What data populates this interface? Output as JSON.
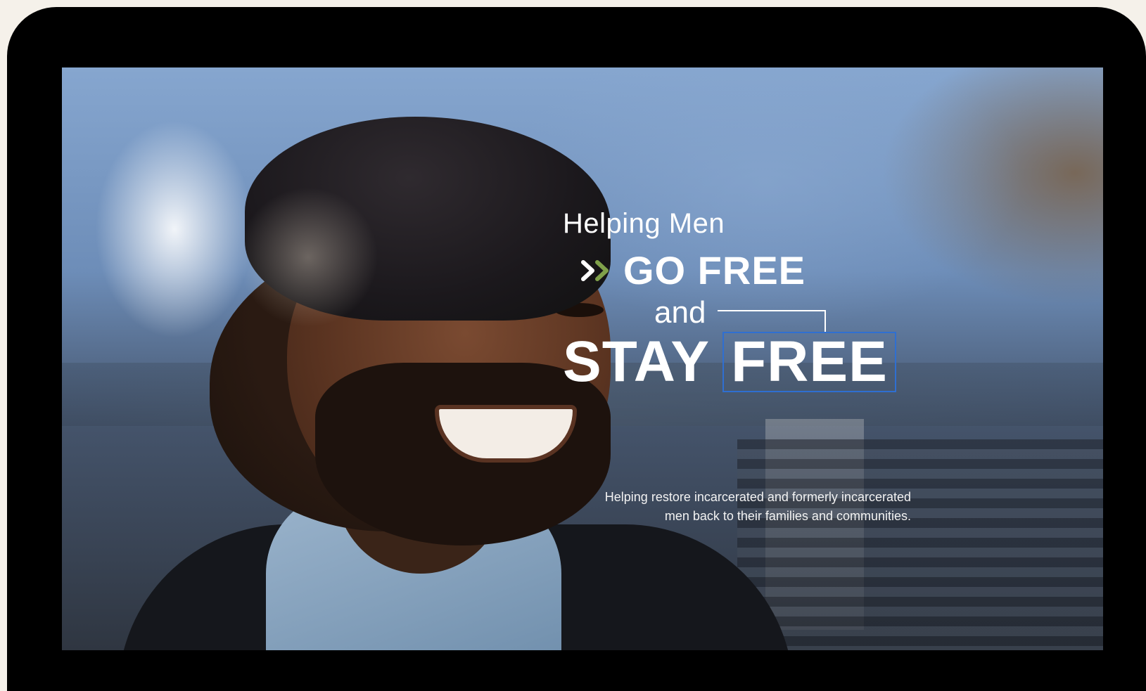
{
  "hero": {
    "intro": "Helping Men",
    "go_free": "GO FREE",
    "and": "and",
    "stay": "STAY",
    "free": "FREE",
    "tagline_line1": "Helping restore incarcerated and formerly incarcerated",
    "tagline_line2": "men back to their families and communities."
  },
  "colors": {
    "frame": "#000000",
    "page_background": "#f5f1ea",
    "chevron_green": "#7fa04a",
    "chevron_white": "#ffffff",
    "free_box_border": "#2f6fd1",
    "text": "#ffffff"
  },
  "icons": {
    "chevrons": "double-chevron-right-icon"
  }
}
